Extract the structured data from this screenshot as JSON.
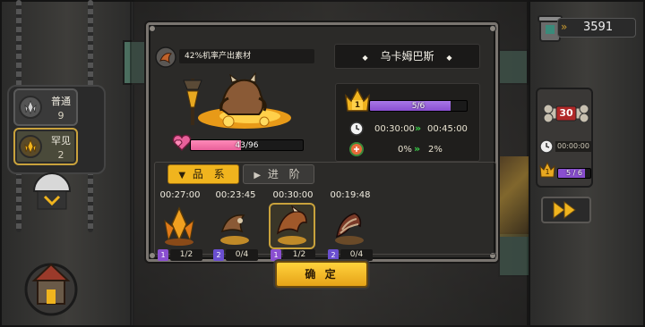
{
  "hud": {
    "coins": "3591"
  },
  "rarity_selector": [
    {
      "label": "普通",
      "count": "9",
      "icon": "gray-crystal-icon",
      "active": false
    },
    {
      "label": "罕见",
      "count": "2",
      "icon": "gold-crystal-icon",
      "active": true
    }
  ],
  "dialog": {
    "drop_text": "42%机率产出素材",
    "monster_name": "乌卡姆巴斯",
    "affection": "43/96",
    "affection_fraction": 0.448,
    "level_bar": "5/6",
    "level_fraction": 0.833,
    "level_badge": "1",
    "time_from": "00:30:00",
    "time_to": "00:45:00",
    "rate_from": "0%",
    "rate_to": "2%",
    "tabs": [
      "品 系",
      "进 阶"
    ],
    "slots": [
      {
        "time": "00:27:00",
        "level": "1",
        "count": "1/2",
        "icon": "orange-crystal-icon",
        "selected": false
      },
      {
        "time": "00:23:45",
        "level": "2",
        "count": "0/4",
        "icon": "wood-claw-icon",
        "selected": false
      },
      {
        "time": "00:30:00",
        "level": "1",
        "count": "1/2",
        "icon": "brown-claw-icon",
        "selected": true
      },
      {
        "time": "00:19:48",
        "level": "2",
        "count": "0/4",
        "icon": "twisted-horn-icon",
        "selected": false
      }
    ],
    "confirm_label": "确 定"
  },
  "right_panel": {
    "counter": "30",
    "timer": "00:00:00",
    "level_badge": "1",
    "level_bar": "5 / 6",
    "level_fraction": 0.833
  },
  "colors": {
    "gold": "#f0b41e",
    "purple": "#8a4fd0",
    "pink": "#e8609a",
    "teal": "#4b6e5f"
  }
}
